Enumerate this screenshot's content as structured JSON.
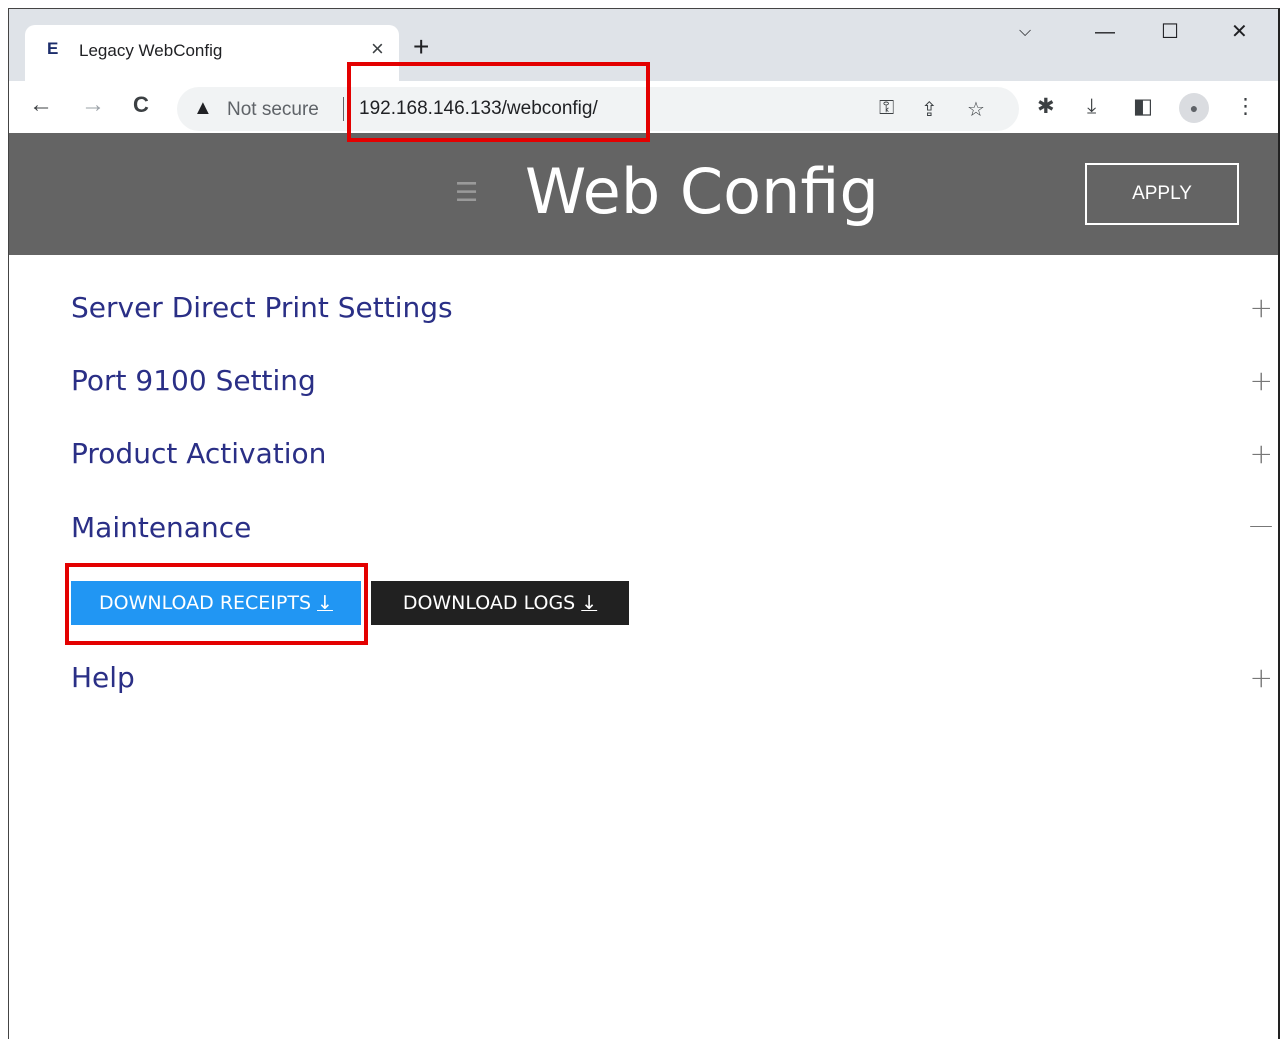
{
  "browser": {
    "tab": {
      "favicon": "E",
      "title": "Legacy WebConfig",
      "close": "×"
    },
    "new_tab": "+",
    "window_controls": {
      "dropdown": "⌵",
      "minimize": "—",
      "maximize": "☐",
      "close": "✕"
    },
    "nav": {
      "back": "←",
      "forward": "→",
      "reload": "C"
    },
    "omnibox": {
      "warning": "▲",
      "security_label": "Not secure",
      "url": "192.168.146.133/webconfig/"
    },
    "omnibox_icons": {
      "key": "⚿",
      "share": "⇪",
      "star": "☆"
    },
    "toolbar_icons": {
      "extensions": "✱",
      "download": "⤓",
      "sidepanel": "◧",
      "avatar": "●",
      "menu": "⋮"
    }
  },
  "header": {
    "icon": "☰",
    "title": "Web Config",
    "apply_label": "APPLY"
  },
  "sections": [
    {
      "title": "Server Direct Print Settings",
      "toggle": "+"
    },
    {
      "title": "Port 9100 Setting",
      "toggle": "+"
    },
    {
      "title": "Product Activation",
      "toggle": "+"
    },
    {
      "title": "Maintenance",
      "toggle": "—"
    },
    {
      "title": "Help",
      "toggle": "+"
    }
  ],
  "maintenance": {
    "download_receipts_label": "DOWNLOAD RECEIPTS",
    "download_logs_label": "DOWNLOAD LOGS",
    "arrow": "↓"
  },
  "colors": {
    "header_bg": "#646464",
    "section_title": "#2a2f86",
    "receipts_button": "#2196f3",
    "logs_button": "#212121",
    "highlight": "#e30000"
  }
}
